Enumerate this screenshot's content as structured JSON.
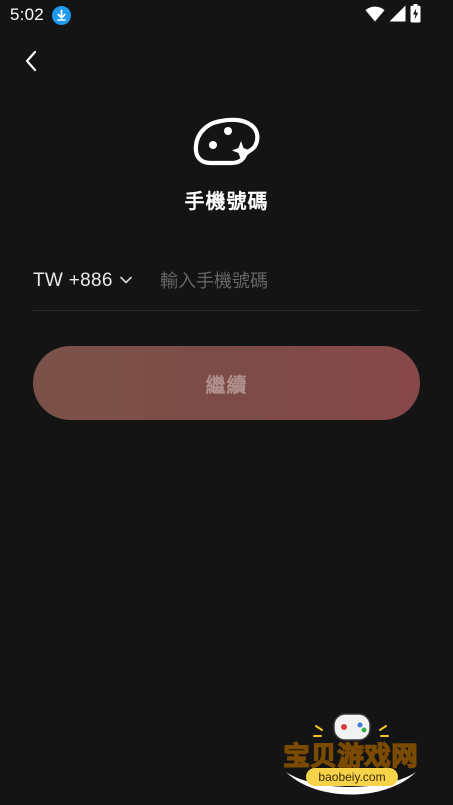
{
  "status_bar": {
    "time": "5:02",
    "icons": [
      "download-icon",
      "wifi-icon",
      "cell-signal-icon",
      "battery-charging-icon"
    ]
  },
  "header": {
    "back_icon": "chevron-left-icon"
  },
  "logo": {
    "icon": "palette-logo-icon"
  },
  "title": "手機號碼",
  "phone": {
    "country_code": "TW +886",
    "dropdown_icon": "chevron-down-icon",
    "placeholder": "輸入手機號碼",
    "value": ""
  },
  "continue_button": {
    "label": "繼續"
  },
  "watermark": {
    "text": "宝贝游戏网",
    "url": "baobeiy.com"
  },
  "colors": {
    "background": "#141414",
    "button_start": "#7b5249",
    "button_end": "#874848",
    "button_text": "#b08f8a",
    "accent_blue": "#1e9bf0"
  }
}
